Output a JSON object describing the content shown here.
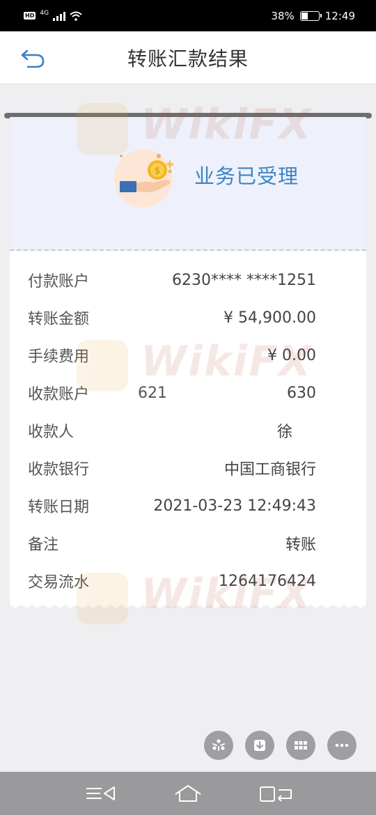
{
  "status_bar": {
    "hd": "HD",
    "network": "4G",
    "battery": "38%",
    "battery_level": 0.38,
    "time": "12:49"
  },
  "header": {
    "title": "转账汇款结果",
    "back_icon": "back-arrow-icon"
  },
  "result": {
    "message": "业务已受理",
    "icon": "hand-coin-icon"
  },
  "details": [
    {
      "label": "付款账户",
      "value": "6230**** ****1251",
      "mid": ""
    },
    {
      "label": "转账金额",
      "value": "¥ 54,900.00",
      "mid": ""
    },
    {
      "label": "手续费用",
      "value": "¥ 0.00",
      "mid": ""
    },
    {
      "label": "收款账户",
      "value": "630",
      "mid": "621"
    },
    {
      "label": "收款人",
      "value": "徐",
      "mid": ""
    },
    {
      "label": "收款银行",
      "value": "中国工商银行",
      "mid": ""
    },
    {
      "label": "转账日期",
      "value": "2021-03-23 12:49:43",
      "mid": ""
    },
    {
      "label": "备注",
      "value": "转账",
      "mid": ""
    },
    {
      "label": "交易流水",
      "value": "1264176424",
      "mid": ""
    }
  ],
  "watermark": "WikiFX",
  "actions": [
    {
      "icon": "share-icon"
    },
    {
      "icon": "download-icon"
    },
    {
      "icon": "grid-icon"
    },
    {
      "icon": "more-icon"
    }
  ],
  "nav": [
    {
      "icon": "menu-back-icon"
    },
    {
      "icon": "home-icon"
    },
    {
      "icon": "recent-apps-icon"
    }
  ],
  "colors": {
    "accent": "#3c83c3",
    "background": "#efeff1",
    "panel": "#eef1fb",
    "fab": "#9e9ea3"
  }
}
